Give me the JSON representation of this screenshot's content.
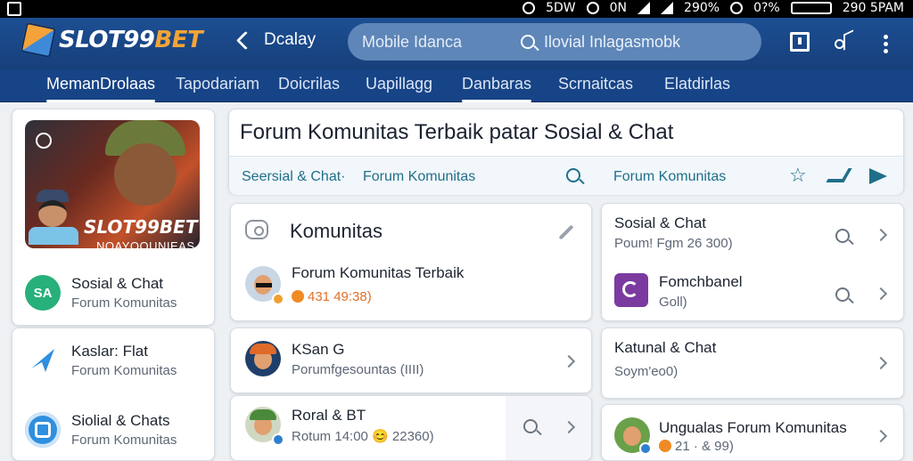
{
  "status_bar": {
    "left_text": "5DW",
    "mid_text": "0N",
    "percent": "290%",
    "battery": "0?%",
    "time": "290 5PAM"
  },
  "app_bar": {
    "brand_main": "SLOT99",
    "brand_accent": "BET",
    "link_label": "Dcalay",
    "search_prefix": "Mobile  Idanca",
    "search_text": "Ilovial Inlagasmobk"
  },
  "tabs": [
    {
      "label": "MemanDrolaas",
      "active": true
    },
    {
      "label": "Tapodariam"
    },
    {
      "label": "Doicrilas"
    },
    {
      "label": "Uapillagg"
    },
    {
      "label": "Danbaras"
    },
    {
      "label": "Scrnaitcas"
    },
    {
      "label": "Elatdirlas"
    }
  ],
  "sidebar": {
    "promo_brand": "SLOT99BET",
    "promo_tagline": "NOAYOOUNIEAS",
    "items": [
      {
        "icon_text": "SA",
        "title": "Sosial & Chat",
        "subtitle": "Forum Komunitas",
        "color": "#28b07a"
      },
      {
        "icon_text": "",
        "title": "Kaslar: Flat",
        "subtitle": "Forum Komunitas",
        "color": "#2f8fe0"
      },
      {
        "icon_text": "",
        "title": "Siolial & Chats",
        "subtitle": "Forum Komunitas",
        "color": "#2f8fe0"
      }
    ]
  },
  "main": {
    "title": "Forum Komunitas Terbaik patar Sosial & Chat",
    "subnav": [
      "Seersial & Chat·",
      "Forum Komunitas",
      "Forum Komunitas"
    ]
  },
  "community": {
    "header": "Komunitas",
    "rows": [
      {
        "title": "Forum Komunitas Terbaik",
        "meta": "431 49:38)"
      },
      {
        "title": "KSan G",
        "meta": "Porumfgesountas (IIII)"
      },
      {
        "title": "Roral & BT",
        "meta": "Rotum 14:00  😊 22360)"
      }
    ]
  },
  "right_list": [
    {
      "title": "Sosial & Chat",
      "meta": "Poum! Fgm 26 300)"
    },
    {
      "title": "Fomchbanel",
      "meta": "Goll)"
    },
    {
      "title": "Katunal & Chat",
      "meta": "Soym'eo0)"
    },
    {
      "title": "Ungualas Forum Komunitas",
      "meta": "21 · & 99)"
    }
  ]
}
